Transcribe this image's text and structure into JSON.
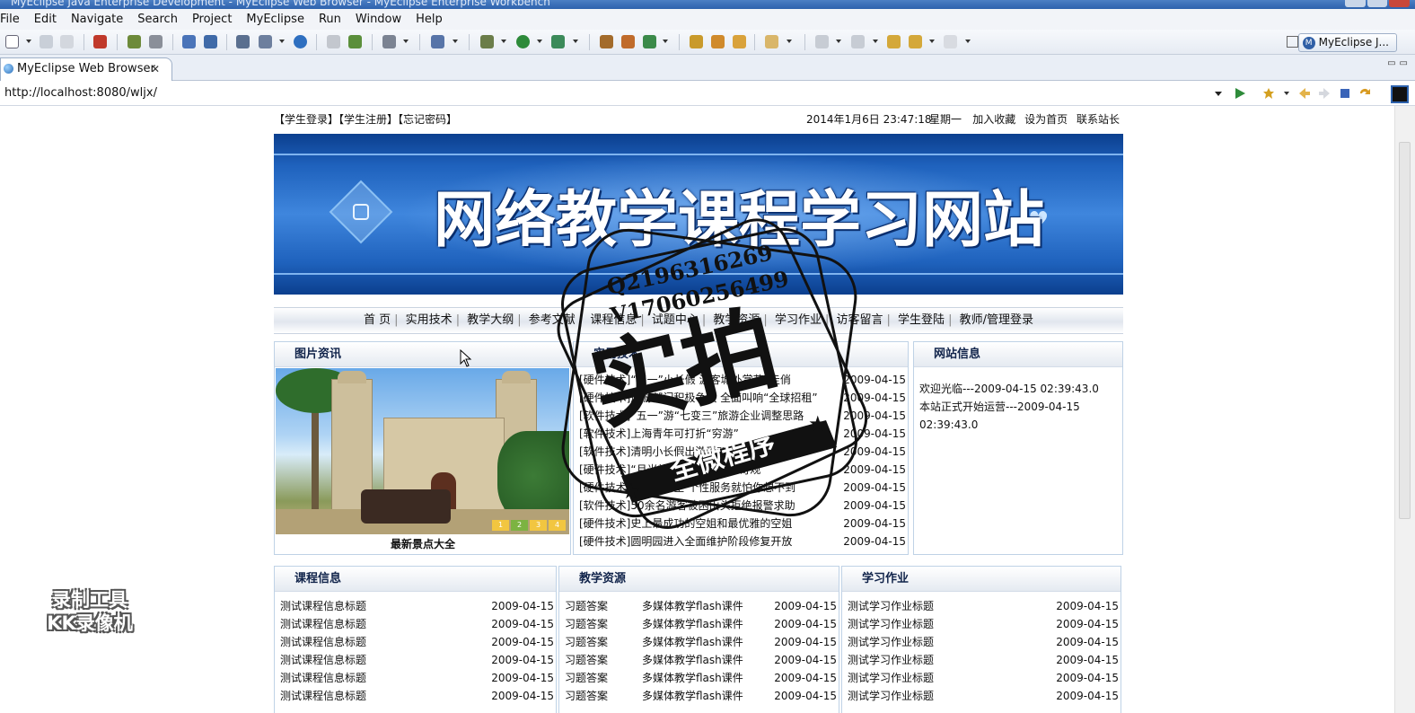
{
  "window": {
    "title": "MyEclipse Java Enterprise Development - MyEclipse Web Browser - MyEclipse Enterprise Workbench"
  },
  "menu": [
    "File",
    "Edit",
    "Navigate",
    "Search",
    "Project",
    "MyEclipse",
    "Run",
    "Window",
    "Help"
  ],
  "perspective": {
    "label": "MyEclipse J..."
  },
  "editor_tab": {
    "label": "MyEclipse Web Browser",
    "close": "✕"
  },
  "address": {
    "url": "http://localhost:8080/wljx/"
  },
  "site": {
    "top_links": [
      "【学生登录】",
      "【学生注册】",
      "【忘记密码】"
    ],
    "date": "2014年1月6日 23:47:18",
    "weekday": "星期一",
    "top_right": [
      "加入收藏",
      "设为首页",
      "联系站长"
    ],
    "banner_title": "网络教学课程学习网站",
    "nav": [
      "首 页",
      "实用技术",
      "教学大纲",
      "参考文献",
      "课程信息",
      "试题中心",
      "教学资源",
      "学习作业",
      "访客留言",
      "学生登陆",
      "教师/管理登录"
    ],
    "photo_box": {
      "title": "图片资讯",
      "caption": "最新景点大全",
      "dots": [
        "1",
        "2",
        "3",
        "4"
      ]
    },
    "tech_box": {
      "title": "实用技术",
      "items": [
        {
          "text": "[硬件技术]“三一”小长假 游客城外赏花”走俏",
          "date": "2009-04-15"
        },
        {
          "text": "[硬件技术]旅游部门积极争议 全面叫响“全球招租”",
          "date": "2009-04-15"
        },
        {
          "text": "[软件技术]“五一”游“七变三”旅游企业调整思路",
          "date": "2009-04-15"
        },
        {
          "text": "[软件技术]上海青年可打折“穷游”",
          "date": "2009-04-15"
        },
        {
          "text": "[软件技术]清明小长假出游受欢迎",
          "date": "2009-04-15"
        },
        {
          "text": "[硬件技术]“月光族”旅游“超火爆”奇观",
          "date": "2009-04-15"
        },
        {
          "text": "[硬件技术]感受星日空 个性服务就怕你想不到",
          "date": "2009-04-15"
        },
        {
          "text": "[软件技术]50余名游客被困山头拒绝报警求助",
          "date": "2009-04-15"
        },
        {
          "text": "[硬件技术]史上最成功的空姐和最优雅的空姐",
          "date": "2009-04-15"
        },
        {
          "text": "[硬件技术]圆明园进入全面维护阶段修复开放",
          "date": "2009-04-15"
        }
      ]
    },
    "site_info": {
      "title": "网站信息",
      "lines": [
        "欢迎光临---2009-04-15 02:39:43.0",
        "本站正式开始运营---2009-04-15",
        "02:39:43.0"
      ]
    },
    "course_box": {
      "title": "课程信息",
      "items": [
        {
          "text": "测试课程信息标题",
          "date": "2009-04-15"
        },
        {
          "text": "测试课程信息标题",
          "date": "2009-04-15"
        },
        {
          "text": "测试课程信息标题",
          "date": "2009-04-15"
        },
        {
          "text": "测试课程信息标题",
          "date": "2009-04-15"
        },
        {
          "text": "测试课程信息标题",
          "date": "2009-04-15"
        },
        {
          "text": "测试课程信息标题",
          "date": "2009-04-15"
        }
      ]
    },
    "resource_box": {
      "title": "教学资源",
      "items": [
        {
          "cat": "习题答案",
          "text": "多媒体教学flash课件",
          "date": "2009-04-15"
        },
        {
          "cat": "习题答案",
          "text": "多媒体教学flash课件",
          "date": "2009-04-15"
        },
        {
          "cat": "习题答案",
          "text": "多媒体教学flash课件",
          "date": "2009-04-15"
        },
        {
          "cat": "习题答案",
          "text": "多媒体教学flash课件",
          "date": "2009-04-15"
        },
        {
          "cat": "习题答案",
          "text": "多媒体教学flash课件",
          "date": "2009-04-15"
        },
        {
          "cat": "习题答案",
          "text": "多媒体教学flash课件",
          "date": "2009-04-15"
        }
      ]
    },
    "homework_box": {
      "title": "学习作业",
      "items": [
        {
          "text": "测试学习作业标题",
          "date": "2009-04-15"
        },
        {
          "text": "测试学习作业标题",
          "date": "2009-04-15"
        },
        {
          "text": "测试学习作业标题",
          "date": "2009-04-15"
        },
        {
          "text": "测试学习作业标题",
          "date": "2009-04-15"
        },
        {
          "text": "测试学习作业标题",
          "date": "2009-04-15"
        },
        {
          "text": "测试学习作业标题",
          "date": "2009-04-15"
        }
      ]
    }
  },
  "watermark": {
    "qq": "Q2196316269",
    "wx": "V17060256499",
    "big": "实拍",
    "ribbon": "全微程序"
  },
  "recorder": {
    "line1": "录制工具",
    "line2": "KK录像机"
  },
  "colors": {
    "title_bar": "#2d62ad",
    "banner": "#1f62bd",
    "box_border": "#bfd2e6"
  }
}
